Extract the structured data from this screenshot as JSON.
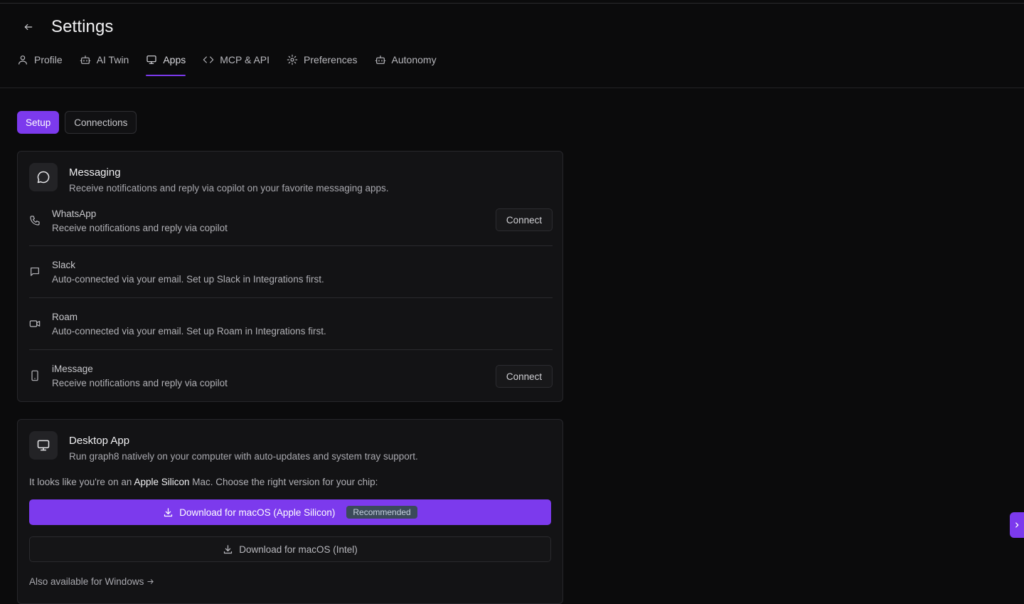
{
  "header": {
    "title": "Settings",
    "tabs": [
      {
        "label": "Profile",
        "icon": "user-icon"
      },
      {
        "label": "AI Twin",
        "icon": "bot-icon"
      },
      {
        "label": "Apps",
        "icon": "monitor-icon",
        "active": true
      },
      {
        "label": "MCP & API",
        "icon": "code-icon"
      },
      {
        "label": "Preferences",
        "icon": "gear-icon"
      },
      {
        "label": "Autonomy",
        "icon": "bot-icon"
      }
    ]
  },
  "segments": {
    "setup": "Setup",
    "connections": "Connections"
  },
  "messaging": {
    "title": "Messaging",
    "description": "Receive notifications and reply via copilot on your favorite messaging apps.",
    "items": [
      {
        "name": "WhatsApp",
        "sub": "Receive notifications and reply via copilot",
        "action": "Connect",
        "icon": "phone-icon"
      },
      {
        "name": "Slack",
        "sub": "Auto-connected via your email. Set up Slack in Integrations first.",
        "icon": "message-square-icon"
      },
      {
        "name": "Roam",
        "sub": "Auto-connected via your email. Set up Roam in Integrations first.",
        "icon": "video-icon"
      },
      {
        "name": "iMessage",
        "sub": "Receive notifications and reply via copilot",
        "action": "Connect",
        "icon": "smartphone-icon"
      }
    ]
  },
  "desktop": {
    "title": "Desktop App",
    "description": "Run graph8 natively on your computer with auto-updates and system tray support.",
    "chip_prefix": "It looks like you're on an",
    "chip_name": "Apple Silicon",
    "chip_suffix": "Mac. Choose the right version for your chip:",
    "primary_download": "Download for macOS (Apple Silicon)",
    "badge": "Recommended",
    "secondary_download": "Download for macOS (Intel)",
    "also": "Also available for Windows"
  },
  "colors": {
    "accent": "#7c3aed",
    "background": "#0b0b0c",
    "card": "#131315"
  }
}
